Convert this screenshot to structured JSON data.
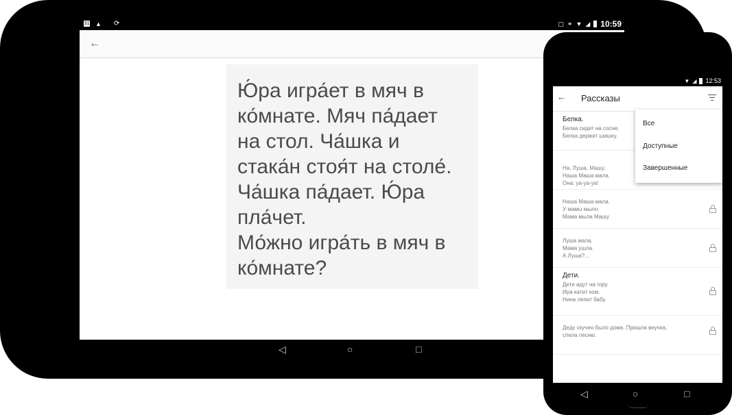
{
  "tablet": {
    "status_time": "10:59",
    "status_left_icons": [
      "calendar-icon",
      "notification-icon",
      "sync-icon"
    ],
    "status_right_icons": [
      "cast-icon",
      "key-icon",
      "wifi-icon",
      "signal-icon",
      "battery-icon"
    ],
    "back_icon": "arrow-back-icon",
    "story_lines": [
      "Ю́ра игра́ет в мяч в",
      "ко́мнате. Мяч па́дает",
      "на стол. Ча́шка и",
      "стака́н стоя́т на столе́.",
      "Ча́шка па́дает. Ю́ра",
      "пла́чет.",
      "Мо́жно игра́ть в мяч в",
      "ко́мнате?"
    ],
    "nav": {
      "back": "◁",
      "home": "○",
      "recents": "□"
    }
  },
  "phone": {
    "status_time": "12:53",
    "title": "Рассказы",
    "back_icon": "arrow-back-icon",
    "filter_icon": "filter-icon",
    "items": [
      {
        "title": "Белка.",
        "lines": [
          "Белка сидит на сосне.",
          "Белка держит шишку."
        ],
        "locked": false
      },
      {
        "title": "",
        "lines": [
          "На, Луша, Машу.",
          "Наша Маша мала.",
          "Она: уа-уа-уа!"
        ],
        "locked": true
      },
      {
        "title": "",
        "lines": [
          "Наша Маша мала.",
          "У мамы мыло.",
          "Мама мыла Машу."
        ],
        "locked": true
      },
      {
        "title": "",
        "lines": [
          "Луша мала.",
          "Мама ушла.",
          "А Луша?..."
        ],
        "locked": true
      },
      {
        "title": "Дети.",
        "lines": [
          "Дети идут на гору.",
          "Ира катит ком.",
          "Нина лепит бабу."
        ],
        "locked": true
      },
      {
        "title": "",
        "lines": [
          "Деду скучно было дома. Пришла внучка,",
          "спела песню."
        ],
        "locked": true
      }
    ],
    "dropdown": [
      "Все",
      "Доступные",
      "Завершенные"
    ],
    "nav": {
      "back": "◁",
      "home": "○",
      "recents": "□"
    }
  }
}
